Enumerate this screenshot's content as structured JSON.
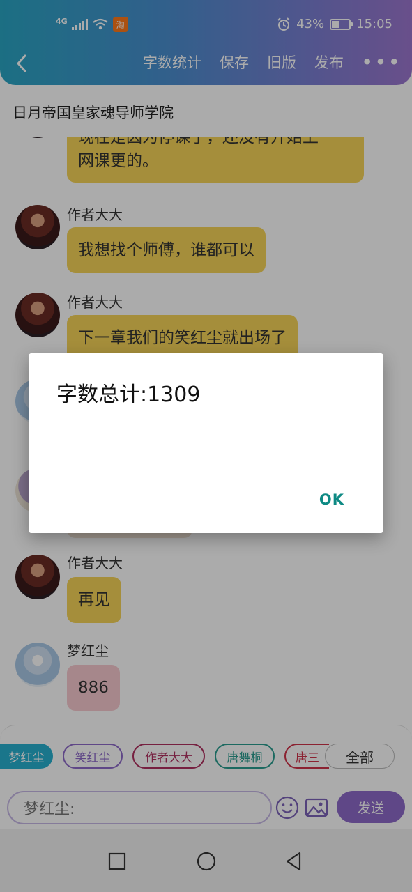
{
  "status_bar": {
    "network": "4G",
    "app_badge": "淘",
    "battery_percent": "43%",
    "battery_level": 0.43,
    "time": "15:05"
  },
  "nav": {
    "back_icon": "chevron-left-icon",
    "actions": [
      "字数统计",
      "保存",
      "旧版",
      "发布"
    ],
    "more_label": "•••"
  },
  "group_title": "日月帝国皇家魂导师学院",
  "messages": [
    {
      "sender": "",
      "text_lines": [
        "现在是因为停课了，还没有开始上",
        "网课更的。"
      ],
      "style": "yellow",
      "avatar": "author"
    },
    {
      "sender": "作者大大",
      "text_lines": [
        "我想找个师傅，谁都可以"
      ],
      "style": "yellow",
      "avatar": "author"
    },
    {
      "sender": "作者大大",
      "text_lines": [
        "下一章我们的笑红尘就出场了"
      ],
      "style": "yellow",
      "avatar": "author"
    },
    {
      "sender": "作者大大",
      "text_lines": [
        "再见"
      ],
      "style": "yellow",
      "avatar": "author"
    },
    {
      "sender": "梦红尘",
      "text_lines": [
        "886"
      ],
      "style": "pink",
      "avatar": "meng"
    }
  ],
  "characters": [
    {
      "label": "梦红尘",
      "color": "#27b0d0",
      "active": true
    },
    {
      "label": "笑红尘",
      "color": "#8e6ac9",
      "active": false
    },
    {
      "label": "作者大大",
      "color": "#b03060",
      "active": false
    },
    {
      "label": "唐舞桐",
      "color": "#2a9d8f",
      "active": false
    },
    {
      "label": "唐三",
      "color": "#d0344a",
      "active": false
    }
  ],
  "all_chip_label": "全部",
  "input": {
    "placeholder": "梦红尘:",
    "emoji_icon": "smiley-icon",
    "image_icon": "image-icon",
    "send_label": "发送"
  },
  "dialog": {
    "title": "字数总计:1309",
    "ok_label": "OK"
  },
  "system_nav": [
    "square-icon",
    "circle-icon",
    "triangle-back-icon"
  ]
}
